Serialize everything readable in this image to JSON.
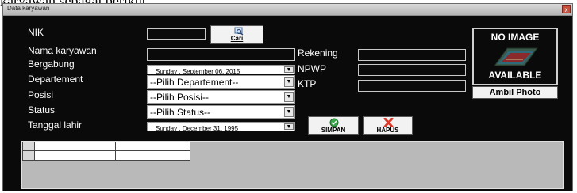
{
  "heading_text": "karyawan sebagai berikut.",
  "window": {
    "title": "Data karyawan",
    "close_glyph": "x"
  },
  "form": {
    "nik_label": "NIK",
    "nama_label": "Nama karyawan",
    "bergabung_label": "Bergabung",
    "departement_label": "Departement",
    "posisi_label": "Posisi",
    "status_label": "Status",
    "tanggal_lahir_label": "Tanggal lahir",
    "rekening_label": "Rekening",
    "npwp_label": "NPWP",
    "ktp_label": "KTP",
    "bergabung_value": "Sunday , September 06, 2015",
    "departement_value": "--Pilih Departement--",
    "posisi_value": "--Pilih Posisi--",
    "status_value": "--Pilih Status--",
    "tanggal_lahir_value": "Sunday , December 31, 1995"
  },
  "buttons": {
    "cari": "Cari",
    "simpan": "SIMPAN",
    "hapus": "HAPUS",
    "ambil_photo": "Ambil Photo"
  },
  "photo": {
    "top_text": "NO IMAGE",
    "bottom_text": "AVAILABLE",
    "icon": "books-icon"
  },
  "colors": {
    "window_bg": "#0a0a0a",
    "label": "#ffffff",
    "delete_red": "#d83a2a",
    "save_green": "#3aa64a"
  }
}
